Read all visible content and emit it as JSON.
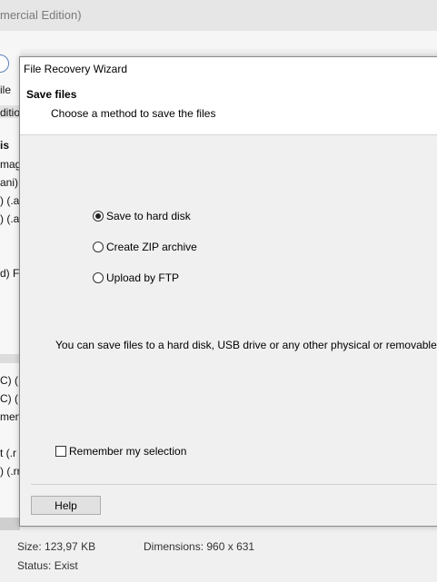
{
  "app": {
    "title_fragment": "mercial Edition)",
    "left_fragments": [
      "ile",
      "ditio",
      "is",
      "mag",
      "ani)",
      ") (.a",
      ") (.av",
      "d) F",
      "C) (.",
      "C) (.",
      "men",
      "t (.r",
      ") (.rr"
    ]
  },
  "dialog": {
    "title": "File Recovery Wizard",
    "header_title": "Save files",
    "header_subtitle": "Choose a method to save the files",
    "options": [
      {
        "label": "Save to hard disk",
        "selected": true
      },
      {
        "label": "Create ZIP archive",
        "selected": false
      },
      {
        "label": "Upload by FTP",
        "selected": false
      }
    ],
    "description": "You can save files to a hard disk, USB drive or any other physical or removable disk",
    "remember_label": "Remember my selection",
    "remember_checked": false,
    "help_label": "Help"
  },
  "status": {
    "size_label": "Size:",
    "size_value": "123,97 KB",
    "dimensions_label": "Dimensions:",
    "dimensions_value": "960 x 631",
    "status_label": "Status:",
    "status_value": "Exist"
  }
}
